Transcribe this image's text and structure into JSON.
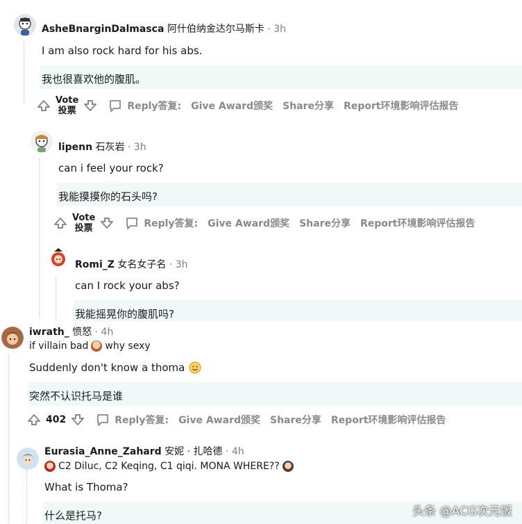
{
  "comments": [
    {
      "user": "AsheBnarginDalmasca",
      "user_cn": "阿什伯纳金达尔马斯卡",
      "time": "· 3h",
      "text": "I am also rock hard for his abs.",
      "trans": "我也很喜欢他的腹肌。",
      "vote_top": "Vote",
      "vote_bottom": "投票"
    },
    {
      "user": "lipenn",
      "user_cn": "石灰岩",
      "time": "· 3h",
      "text": "can i feel your rock?",
      "trans": "我能摸摸你的石头吗?",
      "vote_top": "Vote",
      "vote_bottom": "投票"
    },
    {
      "user": "Romi_Z",
      "user_cn": "女名女子名",
      "time": "· 3h",
      "text": "can I rock your abs?",
      "trans": "我能摇晃你的腹肌吗?"
    },
    {
      "user": "iwrath_",
      "user_cn": "愤怒",
      "time": "· 4h",
      "flair_left": "if villain bad",
      "flair_right": "why sexy",
      "text": "Suddenly don't know a thoma",
      "trans": "突然不认识托马是谁",
      "votes": "402"
    },
    {
      "user": "Eurasia_Anne_Zahard",
      "user_cn": "安妮 · 扎哈德",
      "time": "· 4h",
      "flair": "C2 Diluc, C2 Keqing, C1 qiqi. MONA WHERE??",
      "text": "What is Thoma?",
      "trans": "什么是托马?"
    }
  ],
  "actions": {
    "reply": "Reply答复:",
    "award": "Give Award颁奖",
    "share": "Share分享",
    "report": "Report环境影响评估报告"
  },
  "watermark": "头条 @ACG次元饭",
  "icons": [
    "upvote-icon",
    "downvote-icon",
    "comment-bubble-icon",
    "grin-emoji-icon"
  ],
  "colors": {
    "translation_band": "#f1f8f8",
    "meta_gray": "#7c7c7c",
    "action_gray": "#878a8c"
  }
}
